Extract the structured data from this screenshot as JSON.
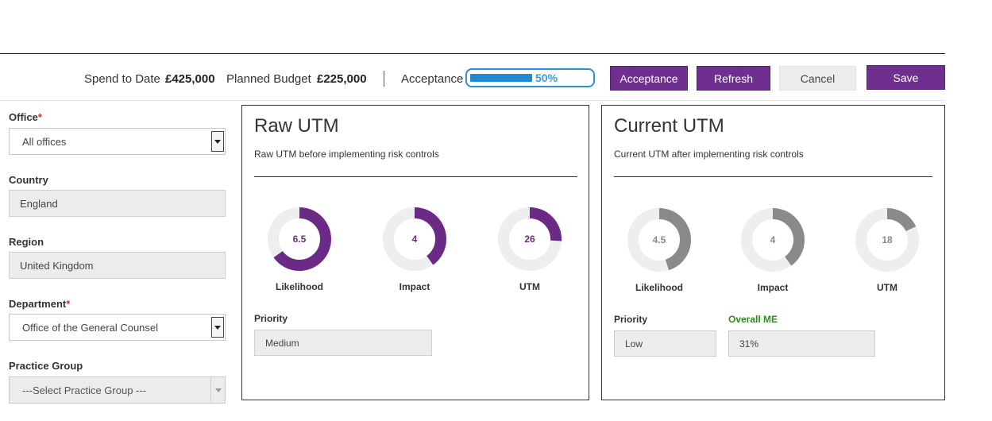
{
  "header": {
    "spend_label": "Spend to Date",
    "spend_value": "£425,000",
    "budget_label": "Planned Budget",
    "budget_value": "£225,000",
    "acceptance_label": "Acceptance",
    "acceptance_progress_percent": 50,
    "acceptance_progress_text": "50%",
    "buttons": {
      "acceptance": "Acceptance",
      "refresh": "Refresh",
      "cancel": "Cancel",
      "save": "Save"
    }
  },
  "form": {
    "office": {
      "label": "Office",
      "required_mark": "*",
      "value": "All offices"
    },
    "country": {
      "label": "Country",
      "value": "England"
    },
    "region": {
      "label": "Region",
      "value": "United Kingdom"
    },
    "department": {
      "label": "Department",
      "required_mark": "*",
      "value": "Office of the General Counsel"
    },
    "practice_group": {
      "label": "Practice Group",
      "value": "---Select Practice Group ---"
    }
  },
  "raw_utm": {
    "title": "Raw UTM",
    "subtitle": "Raw UTM before implementing risk controls",
    "metrics": [
      {
        "label": "Likelihood",
        "value_text": "6.5",
        "fill_fraction": 0.65
      },
      {
        "label": "Impact",
        "value_text": "4",
        "fill_fraction": 0.4
      },
      {
        "label": "UTM",
        "value_text": "26",
        "fill_fraction": 0.26
      }
    ],
    "priority_label": "Priority",
    "priority_value": "Medium"
  },
  "current_utm": {
    "title": "Current UTM",
    "subtitle": "Current UTM after implementing risk controls",
    "metrics": [
      {
        "label": "Likelihood",
        "value_text": "4.5",
        "fill_fraction": 0.45
      },
      {
        "label": "Impact",
        "value_text": "4",
        "fill_fraction": 0.4
      },
      {
        "label": "UTM",
        "value_text": "18",
        "fill_fraction": 0.18
      }
    ],
    "priority_label": "Priority",
    "priority_value": "Low",
    "overall_me_label": "Overall ME",
    "overall_me_value": "31%"
  },
  "colors": {
    "brand_purple": "#6f2f8e",
    "donut_raw": "#6a2a86",
    "donut_current": "#8a8a8a",
    "donut_track": "#eeeeee",
    "progress_blue": "#1f8ad6",
    "overall_me_green": "#2e8b1a",
    "required_red": "#c0392b"
  }
}
